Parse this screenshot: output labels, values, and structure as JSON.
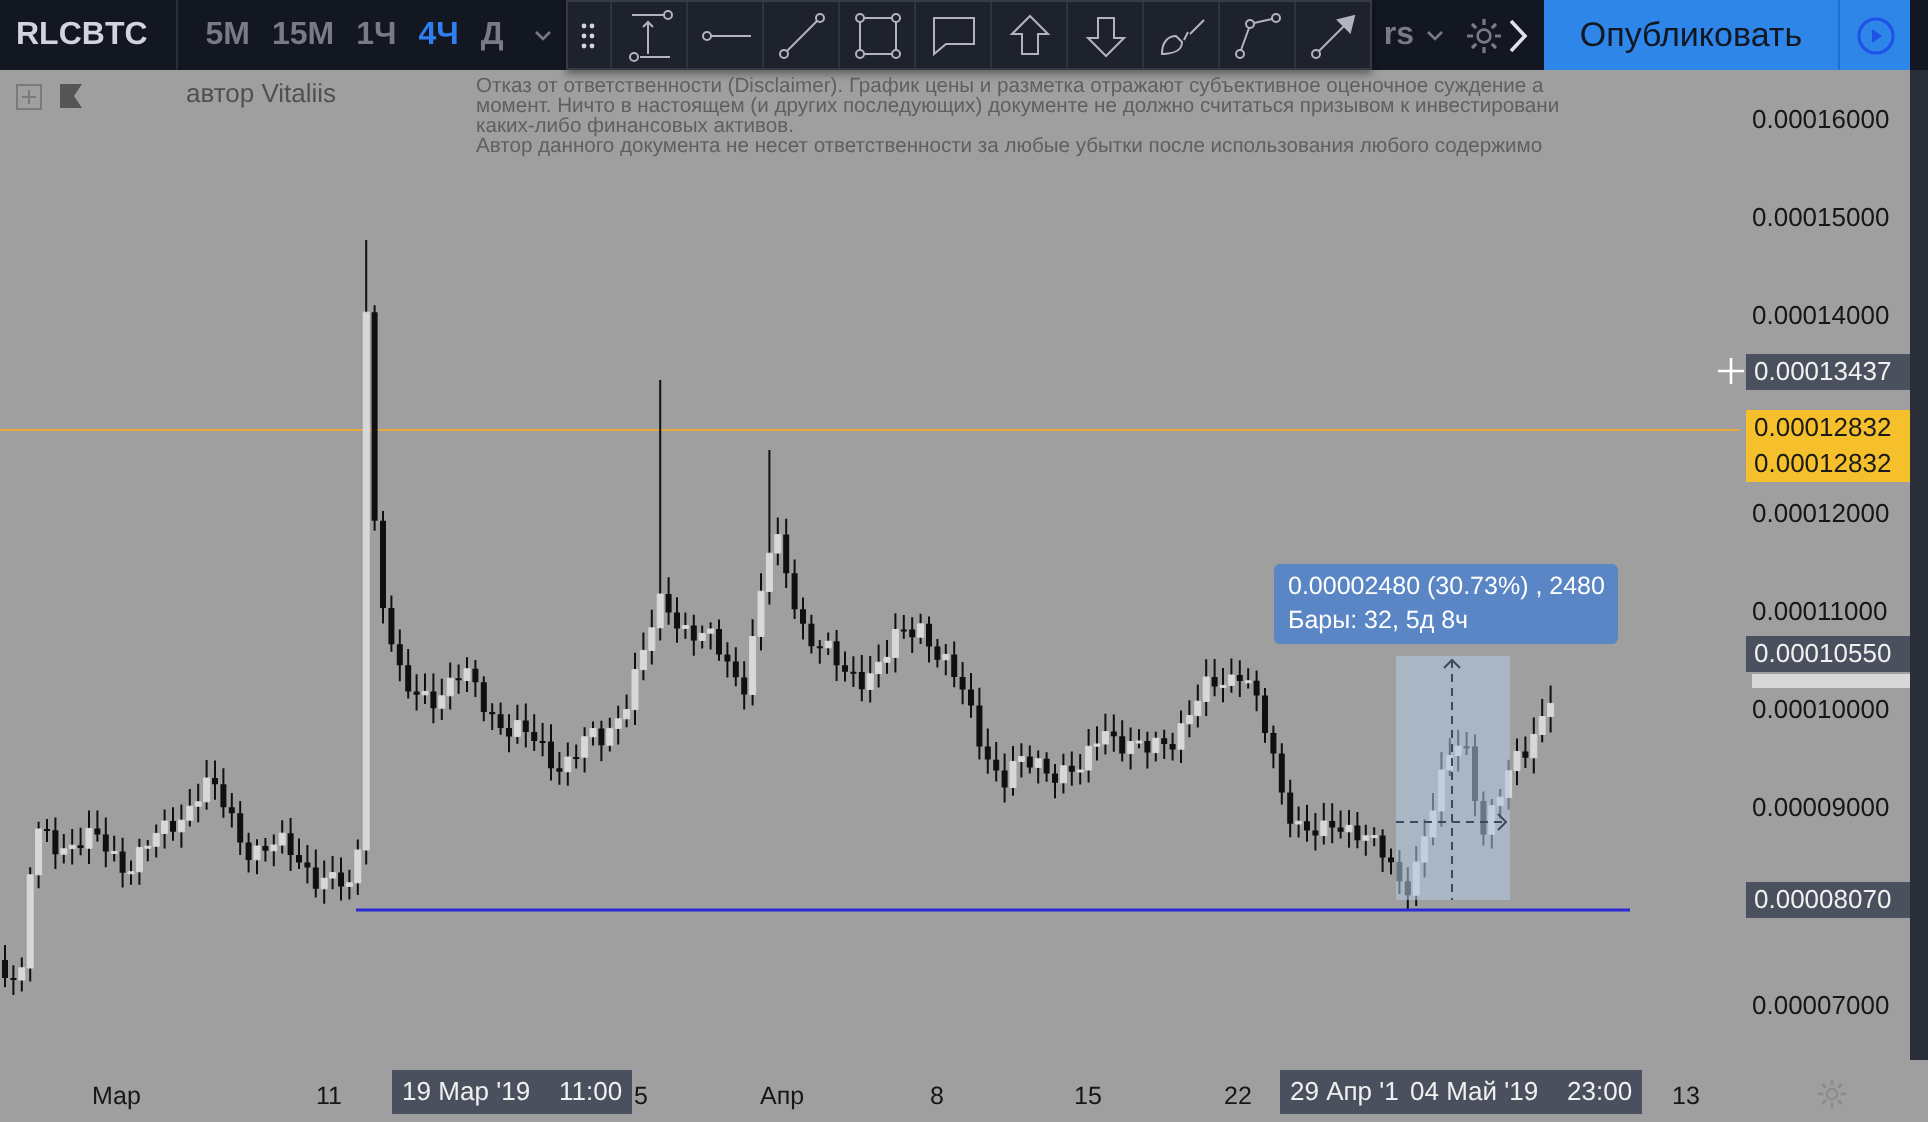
{
  "toolbar": {
    "symbol": "RLCBTC",
    "intervals": [
      {
        "label": "5M",
        "selected": false
      },
      {
        "label": "15M",
        "selected": false
      },
      {
        "label": "1Ч",
        "selected": false
      },
      {
        "label": "4Ч",
        "selected": true
      },
      {
        "label": "Д",
        "selected": false
      }
    ],
    "hidden_label": "rs",
    "publish_button": "Опубликовать"
  },
  "chart": {
    "author": "автор Vitaliis",
    "disclaimer": [
      "Отказ от ответственности (Disclaimer). График цены и разметка отражают субъективное оценочное суждение а",
      "момент. Ничто в настоящем (и других последующих) документе не должно считаться призывом к инвестировани",
      "каких-либо финансовых активов.",
      "Автор данного документа не несет ответственности за любые убытки после использования любого содержимо"
    ],
    "measure": {
      "line_1": "0.00002480 (30.73%) , 2480",
      "line_2": "Бары: 32, 5д 8ч"
    }
  },
  "price_axis": {
    "ticks": [
      "0.00016000",
      "0.00015000",
      "0.00014000",
      "0.00012000",
      "0.00011000",
      "0.00010000",
      "0.00009000",
      "0.00007000"
    ],
    "labels": [
      {
        "kind": "crosshair",
        "text": "0.00013437"
      },
      {
        "kind": "line",
        "text": "0.00012832"
      },
      {
        "kind": "line",
        "text": "0.00012832"
      },
      {
        "kind": "last",
        "text": "0.00010550"
      },
      {
        "kind": "last",
        "text": "0.00008070"
      }
    ]
  },
  "time_axis": {
    "ticks": [
      "Мар",
      "11",
      "5",
      "Апр",
      "8",
      "15",
      "22",
      "13"
    ],
    "labels": [
      {
        "date": "19 Мар '19",
        "time": "11:00"
      },
      {
        "date": "29 Апр '1"
      },
      {
        "date": "04 Май '19",
        "time": "23:00"
      }
    ]
  }
}
